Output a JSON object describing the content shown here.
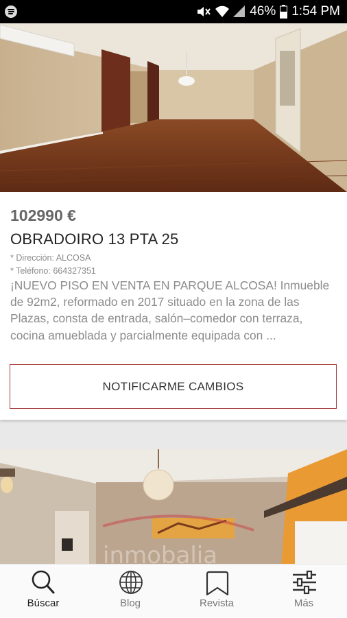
{
  "status_bar": {
    "battery": "46%",
    "time": "1:54 PM"
  },
  "listing": {
    "price": "102990 €",
    "title": "OBRADOIRO 13 PTA 25",
    "direccion": "* Dirección: ALCOSA",
    "telefono": "* Teléfono: 664327351",
    "description": "¡NUEVO PISO EN VENTA EN PARQUE ALCOSA! Inmueble de 92m2, reformado en 2017 situado en la zona de las Plazas, consta de entrada, salón–comedor con terraza, cocina amueblada y parcialmente equipada con ...",
    "notify_button": "NOTIFICARME CAMBIOS"
  },
  "nav": {
    "items": [
      {
        "label": "Búscar",
        "icon": "search-icon",
        "active": true
      },
      {
        "label": "Blog",
        "icon": "globe-icon",
        "active": false
      },
      {
        "label": "Revista",
        "icon": "bookmark-icon",
        "active": false
      },
      {
        "label": "Más",
        "icon": "sliders-icon",
        "active": false
      }
    ]
  },
  "colors": {
    "accent_border": "#a53a3a",
    "status_bar": "#000000",
    "nav_background": "#fafafa"
  }
}
